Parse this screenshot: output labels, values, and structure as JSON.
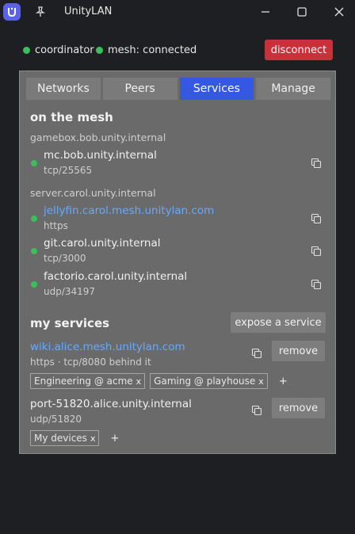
{
  "window": {
    "title": "UnityLAN"
  },
  "status": {
    "coordinator_label": "coordinator",
    "mesh_label": "mesh: connected",
    "disconnect_label": "disconnect"
  },
  "tabs": [
    {
      "label": "Networks",
      "active": false
    },
    {
      "label": "Peers",
      "active": false
    },
    {
      "label": "Services",
      "active": true
    },
    {
      "label": "Manage",
      "active": false
    }
  ],
  "mesh": {
    "heading": "on the mesh",
    "hosts": [
      {
        "name": "gamebox.bob.unity.internal",
        "services": [
          {
            "name": "mc.bob.unity.internal",
            "proto": "tcp/25565",
            "link": false
          }
        ]
      },
      {
        "name": "server.carol.unity.internal",
        "services": [
          {
            "name": "jellyfin.carol.mesh.unitylan.com",
            "proto": "https",
            "link": true
          },
          {
            "name": "git.carol.unity.internal",
            "proto": "tcp/3000",
            "link": false
          },
          {
            "name": "factorio.carol.unity.internal",
            "proto": "udp/34197",
            "link": false
          }
        ]
      }
    ]
  },
  "my_services": {
    "heading": "my services",
    "expose_label": "expose a service",
    "remove_label": "remove",
    "add_tag_label": "+",
    "tag_close": "x",
    "items": [
      {
        "name": "wiki.alice.mesh.unitylan.com",
        "proto": "https  ·  tcp/8080 behind it",
        "link": true,
        "tags": [
          "Engineering @ acme",
          "Gaming @ playhouse"
        ]
      },
      {
        "name": "port-51820.alice.unity.internal",
        "proto": "udp/51820",
        "link": false,
        "tags": [
          "My devices"
        ]
      }
    ]
  }
}
